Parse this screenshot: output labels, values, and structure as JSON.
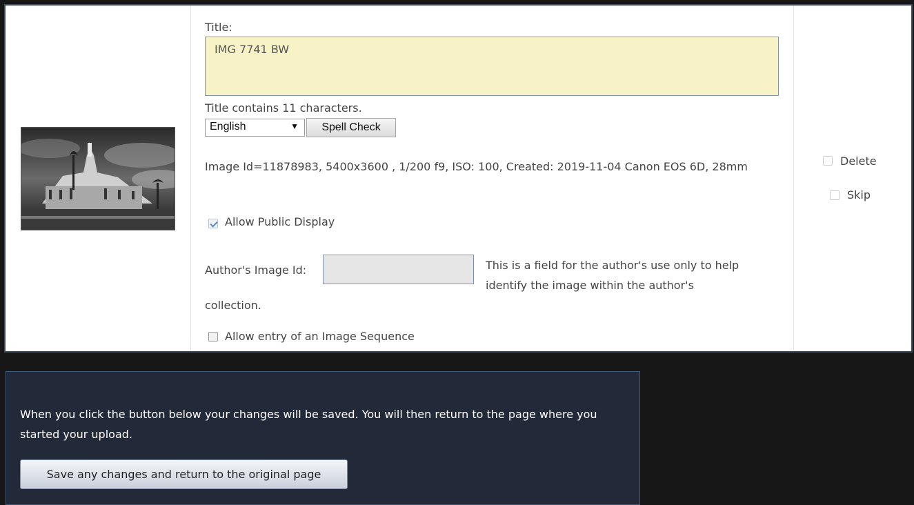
{
  "image_row": {
    "thumbnail_alt": "IMG 7741 BW",
    "title_label": "Title:",
    "title_value": "IMG 7741 BW",
    "title_count": "Title contains 11 characters.",
    "language_selected": "English",
    "spell_check_label": "Spell Check",
    "info": "Image Id=11878983, 5400x3600 , 1/200 f9, ISO: 100, Created: 2019-11-04 Canon EOS 6D, 28mm",
    "public_display_label": "Allow Public Display",
    "public_display_checked": true,
    "author_id_label": "Author's Image Id:",
    "author_id_value": "",
    "author_help": "This is a field for the author's use only to help identify the image within the author's",
    "collection_text": "collection.",
    "sequence_label": "Allow entry of an Image Sequence",
    "sequence_checked": false,
    "delete_label": "Delete",
    "skip_label": "Skip"
  },
  "save_panel": {
    "text": "When you click the button below your changes will be saved. You will then return to the page where you started your upload.",
    "button_label": "Save any changes and return to the original page"
  },
  "colors": {
    "page_background": "#171717",
    "title_field_background": "#f7f3c7",
    "panel_background": "#222a3a"
  }
}
